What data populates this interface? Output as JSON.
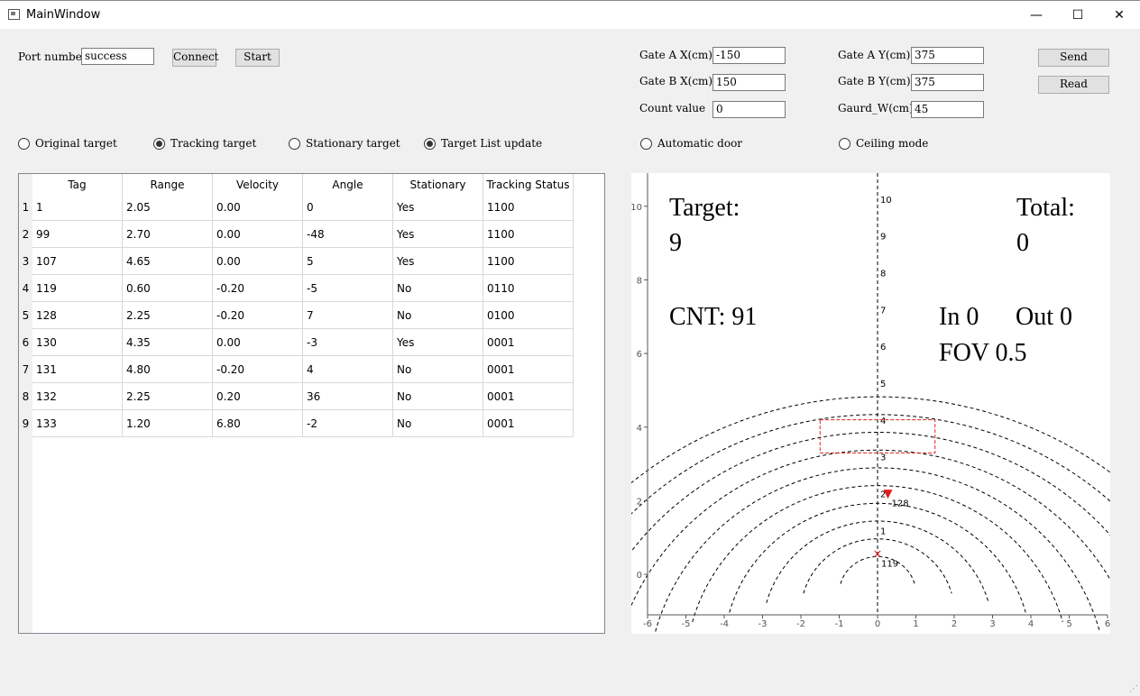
{
  "window": {
    "title": "MainWindow",
    "minimize": "—",
    "maximize": "☐",
    "close": "✕"
  },
  "connection": {
    "port_label": "Port number",
    "port_value": "success",
    "connect_label": "Connect",
    "start_label": "Start"
  },
  "gate_settings": {
    "gate_a_x_label": "Gate A X(cm)",
    "gate_a_x_value": "-150",
    "gate_b_x_label": "Gate B X(cm)",
    "gate_b_x_value": "150",
    "count_label": "Count value",
    "count_value": "0",
    "gate_a_y_label": "Gate A Y(cm)",
    "gate_a_y_value": "375",
    "gate_b_y_label": "Gate B Y(cm)",
    "gate_b_y_value": "375",
    "guard_w_label": "Gaurd_W(cm)",
    "guard_w_value": "45",
    "send_label": "Send",
    "read_label": "Read"
  },
  "modes": [
    {
      "label": "Original target",
      "checked": false
    },
    {
      "label": "Tracking target",
      "checked": true
    },
    {
      "label": "Stationary target",
      "checked": false
    },
    {
      "label": "Target List update",
      "checked": true
    },
    {
      "label": "Automatic door",
      "checked": false
    },
    {
      "label": "Ceiling mode",
      "checked": false
    }
  ],
  "table": {
    "columns": [
      "Tag",
      "Range",
      "Velocity",
      "Angle",
      "Stationary",
      "Tracking Status"
    ],
    "row_numbers": [
      "1",
      "2",
      "3",
      "4",
      "5",
      "6",
      "7",
      "8",
      "9"
    ],
    "rows": [
      [
        "1",
        "2.05",
        "0.00",
        "0",
        "Yes",
        "1100"
      ],
      [
        "99",
        "2.70",
        "0.00",
        "-48",
        "Yes",
        "1100"
      ],
      [
        "107",
        "4.65",
        "0.00",
        "5",
        "Yes",
        "1100"
      ],
      [
        "119",
        "0.60",
        "-0.20",
        "-5",
        "No",
        "0110"
      ],
      [
        "128",
        "2.25",
        "-0.20",
        "7",
        "No",
        "0100"
      ],
      [
        "130",
        "4.35",
        "0.00",
        "-3",
        "Yes",
        "0001"
      ],
      [
        "131",
        "4.80",
        "-0.20",
        "4",
        "No",
        "0001"
      ],
      [
        "132",
        "2.25",
        "0.20",
        "36",
        "No",
        "0001"
      ],
      [
        "133",
        "1.20",
        "6.80",
        "-2",
        "No",
        "0001"
      ]
    ]
  },
  "plot": {
    "overlay": {
      "target_label": "Target:",
      "target_value": "9",
      "total_label": "Total:",
      "total_value": "0",
      "cnt_text": "CNT: 91",
      "in_text": "In 0",
      "out_text": "Out 0",
      "fov_text": "FOV 0.5"
    },
    "x_range": [
      -6,
      6
    ],
    "y_range": [
      -1.1,
      10.9
    ],
    "x_ticks": [
      "-6",
      "-5",
      "-4",
      "-3",
      "-2",
      "-1",
      "0",
      "1",
      "2",
      "3",
      "4",
      "5",
      "6"
    ],
    "y_ticks": [
      "0",
      "2",
      "4",
      "6",
      "8",
      "10"
    ],
    "ring_labels": [
      "1",
      "2",
      "3",
      "4",
      "5",
      "6",
      "7",
      "8",
      "9",
      "10"
    ],
    "gate_box": {
      "x0": -1.5,
      "x1": 1.5,
      "y0": 3.3,
      "y1": 4.2,
      "color": "#e02020"
    },
    "targets": [
      {
        "tag": "119",
        "label": "119",
        "x": 0.0,
        "y": 0.55,
        "marker": "×"
      },
      {
        "tag": "128",
        "label": "128",
        "x": 0.27,
        "y": 2.2,
        "marker": "▼"
      }
    ],
    "marker_color": "#e02020"
  }
}
